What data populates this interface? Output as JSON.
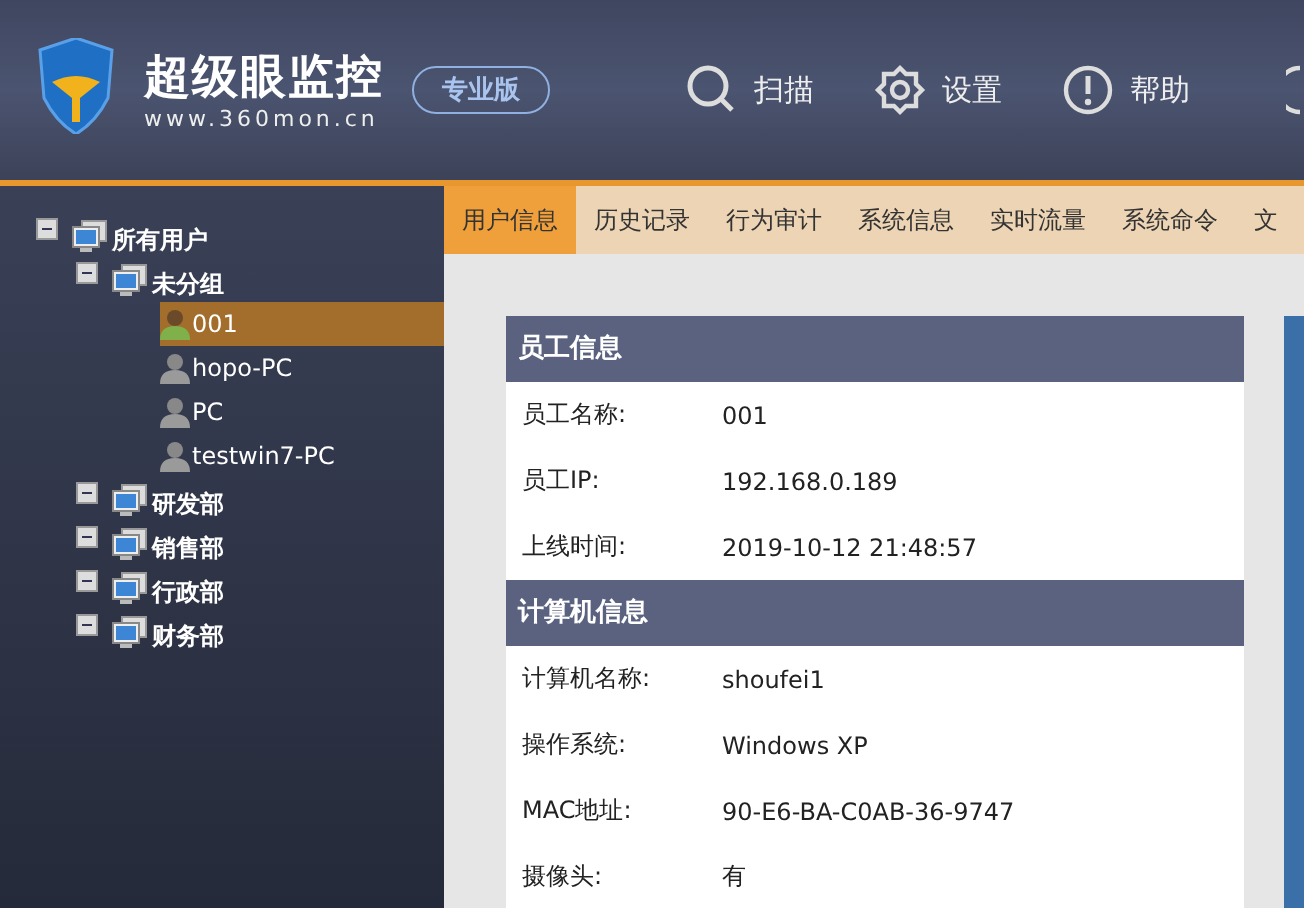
{
  "header": {
    "brand": "超级眼监控",
    "url": "www.360mon.cn",
    "edition": "专业版",
    "menu": [
      {
        "label": "扫描",
        "kind": "search"
      },
      {
        "label": "设置",
        "kind": "gear"
      },
      {
        "label": "帮助",
        "kind": "help"
      }
    ]
  },
  "tree": [
    {
      "label": "所有用户",
      "kind": "group",
      "expanded": true,
      "children": [
        {
          "label": "未分组",
          "kind": "group",
          "expanded": true,
          "children": [
            {
              "label": "001",
              "kind": "user",
              "selected": true,
              "online": true
            },
            {
              "label": "hopo-PC",
              "kind": "user",
              "selected": false,
              "online": false
            },
            {
              "label": "PC",
              "kind": "user",
              "selected": false,
              "online": false
            },
            {
              "label": "testwin7-PC",
              "kind": "user",
              "selected": false,
              "online": false
            }
          ]
        },
        {
          "label": "研发部",
          "kind": "group",
          "expanded": true
        },
        {
          "label": "销售部",
          "kind": "group",
          "expanded": true
        },
        {
          "label": "行政部",
          "kind": "group",
          "expanded": true
        },
        {
          "label": "财务部",
          "kind": "group",
          "expanded": true
        }
      ]
    }
  ],
  "tabs": [
    {
      "label": "用户信息",
      "selected": true
    },
    {
      "label": "历史记录",
      "selected": false
    },
    {
      "label": "行为审计",
      "selected": false
    },
    {
      "label": "系统信息",
      "selected": false
    },
    {
      "label": "实时流量",
      "selected": false
    },
    {
      "label": "系统命令",
      "selected": false
    },
    {
      "label": "文",
      "selected": false
    }
  ],
  "sections": [
    {
      "title": "员工信息",
      "rows": [
        {
          "label": "员工名称:",
          "value": "001"
        },
        {
          "label": "员工IP:",
          "value": "192.168.0.189"
        },
        {
          "label": "上线时间:",
          "value": "2019-10-12 21:48:57"
        }
      ]
    },
    {
      "title": "计算机信息",
      "rows": [
        {
          "label": "计算机名称:",
          "value": "shoufei1"
        },
        {
          "label": "操作系统:",
          "value": "Windows XP"
        },
        {
          "label": "MAC地址:",
          "value": "90-E6-BA-C0AB-36-9747"
        },
        {
          "label": "摄像头:",
          "value": "有"
        }
      ]
    }
  ]
}
